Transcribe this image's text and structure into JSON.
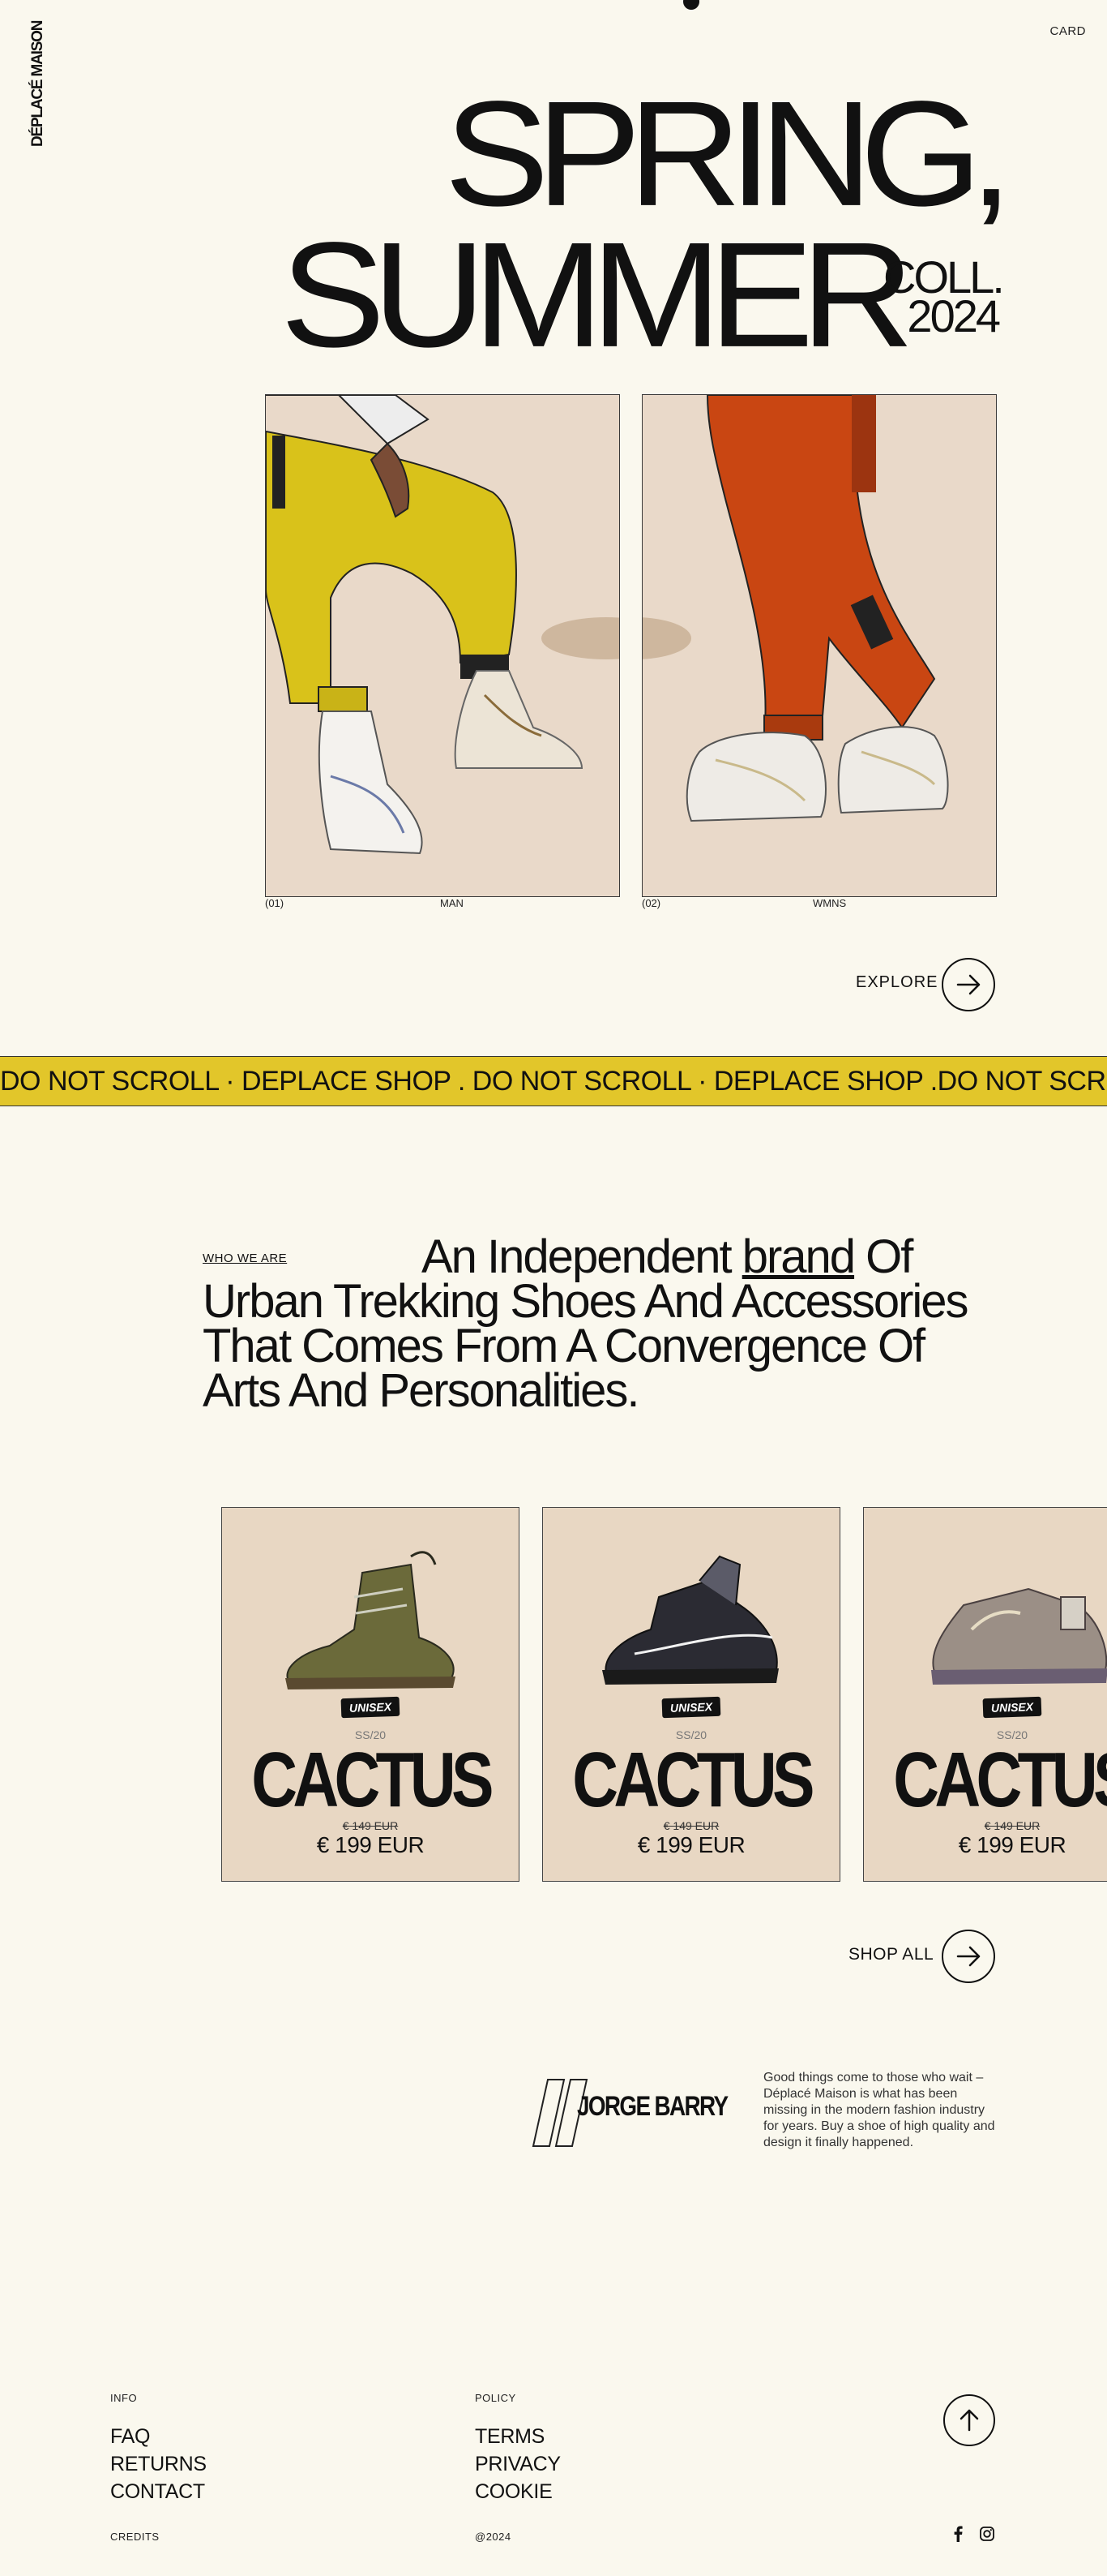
{
  "header": {
    "logo_text": "DÉPLACÉ MAISON",
    "card_link": "CARD"
  },
  "hero": {
    "line1": "SPRING,",
    "line2": "SUMMER",
    "coll_line1": "COLL.",
    "coll_line2": "2024"
  },
  "collections": [
    {
      "index": "(01)",
      "label": "MAN"
    },
    {
      "index": "(02)",
      "label": "WMNS"
    }
  ],
  "explore": {
    "label": "EXPLORE"
  },
  "marquee": {
    "text": "DO NOT SCROLL · DEPLACE SHOP . DO NOT SCROLL · DEPLACE SHOP .DO NOT SCROLL · DEPLACE SHOP . DO NOT SCROLL"
  },
  "about": {
    "section_label": "WHO WE ARE",
    "text_before": "An Independent ",
    "link_word": "brand",
    "text_after": " Of Urban Trekking Shoes And Accessories That Comes From A Convergence Of Arts And Personalities."
  },
  "products": [
    {
      "badge": "UNISEX",
      "season": "SS/20",
      "name": "CACTUS",
      "old_price": "€ 149 EUR",
      "price": "€ 199 EUR",
      "shoe_color": "#6b6a3a"
    },
    {
      "badge": "UNISEX",
      "season": "SS/20",
      "name": "CACTUS",
      "old_price": "€ 149 EUR",
      "price": "€ 199 EUR",
      "shoe_color": "#2b2b33"
    },
    {
      "badge": "UNISEX",
      "season": "SS/20",
      "name": "CACTUS",
      "old_price": "€ 149 EUR",
      "price": "€ 199 EUR",
      "shoe_color": "#9b8f86"
    }
  ],
  "shop_all": {
    "label": "SHOP ALL"
  },
  "testimonial": {
    "signature": "JORGE BARRY",
    "quote": "Good things come to those who wait – Déplacé Maison is what has been missing in the modern fashion industry for years. Buy a shoe of high quality and design it finally happened."
  },
  "footer": {
    "info_label": "INFO",
    "info_links": [
      "FAQ",
      "RETURNS",
      "CONTACT"
    ],
    "policy_label": "POLICY",
    "policy_links": [
      "TERMS",
      "PRIVACY",
      "COOKIE"
    ],
    "credits": "CREDITS",
    "copyright": "@2024",
    "social_icons": [
      "facebook-icon",
      "instagram-icon"
    ]
  },
  "colors": {
    "background": "#faf8ee",
    "marquee": "#e2c62a",
    "card": "#e8d7c3"
  }
}
